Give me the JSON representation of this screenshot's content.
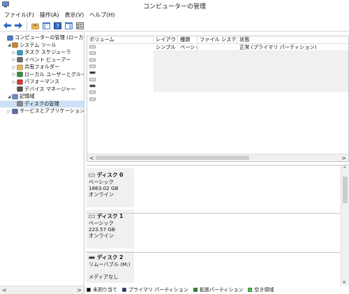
{
  "window": {
    "title": "コンピューターの管理"
  },
  "menu": [
    "ファイル(F)",
    "操作(A)",
    "表示(V)",
    "ヘルプ(H)"
  ],
  "tree": [
    {
      "label": "コンピューターの管理 (ローカル)",
      "indent": 0,
      "arrow": "",
      "icon": "computer"
    },
    {
      "label": "システム ツール",
      "indent": 1,
      "arrow": "◢",
      "icon": "tools"
    },
    {
      "label": "タスク スケジューラ",
      "indent": 2,
      "arrow": "▷",
      "icon": "clock"
    },
    {
      "label": "イベント ビューアー",
      "indent": 2,
      "arrow": "▷",
      "icon": "viewer"
    },
    {
      "label": "共有フォルダー",
      "indent": 2,
      "arrow": "▷",
      "icon": "folder"
    },
    {
      "label": "ローカル ユーザーとグループ",
      "indent": 2,
      "arrow": "▷",
      "icon": "users"
    },
    {
      "label": "パフォーマンス",
      "indent": 2,
      "arrow": "▷",
      "icon": "perf"
    },
    {
      "label": "デバイス マネージャー",
      "indent": 2,
      "arrow": "",
      "icon": "device"
    },
    {
      "label": "記憶域",
      "indent": 1,
      "arrow": "◢",
      "icon": "storage"
    },
    {
      "label": "ディスクの管理",
      "indent": 2,
      "arrow": "",
      "icon": "disk",
      "selected": true
    },
    {
      "label": "サービスとアプリケーション",
      "indent": 1,
      "arrow": "▷",
      "icon": "services"
    }
  ],
  "volumes": {
    "columns": [
      "ボリューム",
      "レイアウト",
      "種類",
      "ファイル システム",
      "状態"
    ],
    "rows": [
      {
        "icon": "drive",
        "layout": "シンプル",
        "type": "ベーシック",
        "fs": "",
        "status": "正常 (プライマリ パーティション)"
      },
      {
        "icon": "drive",
        "layout": "",
        "type": "",
        "fs": "",
        "status": ""
      },
      {
        "icon": "drive",
        "layout": "",
        "type": "",
        "fs": "",
        "status": ""
      },
      {
        "icon": "drive",
        "layout": "",
        "type": "",
        "fs": "",
        "status": ""
      },
      {
        "icon": "removable",
        "layout": "",
        "type": "",
        "fs": "",
        "status": ""
      },
      {
        "icon": "drive",
        "layout": "",
        "type": "",
        "fs": "",
        "status": ""
      },
      {
        "icon": "removable",
        "layout": "",
        "type": "",
        "fs": "",
        "status": ""
      },
      {
        "icon": "drive",
        "layout": "",
        "type": "",
        "fs": "",
        "status": ""
      },
      {
        "icon": "drive",
        "layout": "",
        "type": "",
        "fs": "",
        "status": ""
      }
    ]
  },
  "disks": [
    {
      "name": "ディスク 0",
      "line1": "ベーシック",
      "line2": "1863.02 GB",
      "line3": "オンライン",
      "icon": "drive"
    },
    {
      "name": "ディスク 1",
      "line1": "ベーシック",
      "line2": "223.57 GB",
      "line3": "オンライン",
      "icon": "drive"
    },
    {
      "name": "ディスク 2",
      "line1": "リムーバブル (M:)",
      "line2": "",
      "line3": "メディアなし",
      "icon": "removable"
    }
  ],
  "legend": [
    {
      "label": "未割り当て",
      "color": "#000000"
    },
    {
      "label": "プライマリ パーティション",
      "color": "#1b2b8f"
    },
    {
      "label": "拡張パーティション",
      "color": "#1d8a1d"
    },
    {
      "label": "空き領域",
      "color": "#37d437"
    }
  ]
}
